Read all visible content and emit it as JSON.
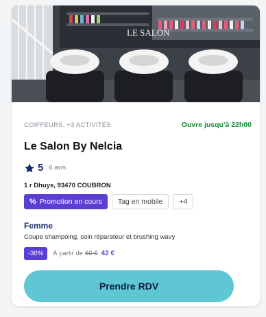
{
  "listing": {
    "category": "COIFFEURS, +3 ACTIVITÉS",
    "opening": "Ouvre jusqu'à 22h00",
    "name": "Le Salon By Nelcia",
    "rating": "5",
    "reviews": "6 avis",
    "address": "1 r Dhuys, 93470 COUBRON",
    "photo_sign": "LE SALON",
    "tags": {
      "promo": "Promotion en cours",
      "promo_icon": "percent-icon",
      "mobile": "Tag en mobile",
      "more": "+4"
    },
    "service": {
      "title": "Femme",
      "description": "Coupe shampoing, soin réparateur et brushing wavy",
      "discount": "-30%",
      "from_label": "À partir de",
      "old_price": "60 €",
      "new_price": "42 €"
    },
    "cta": "Prendre RDV"
  },
  "icons": {
    "rating": "star-icon",
    "promo": "percent-icon"
  },
  "colors": {
    "accent": "#5b3fd4",
    "cta": "#5ec7d3",
    "open_status": "#168a3b",
    "navy": "#1b2a6b"
  }
}
